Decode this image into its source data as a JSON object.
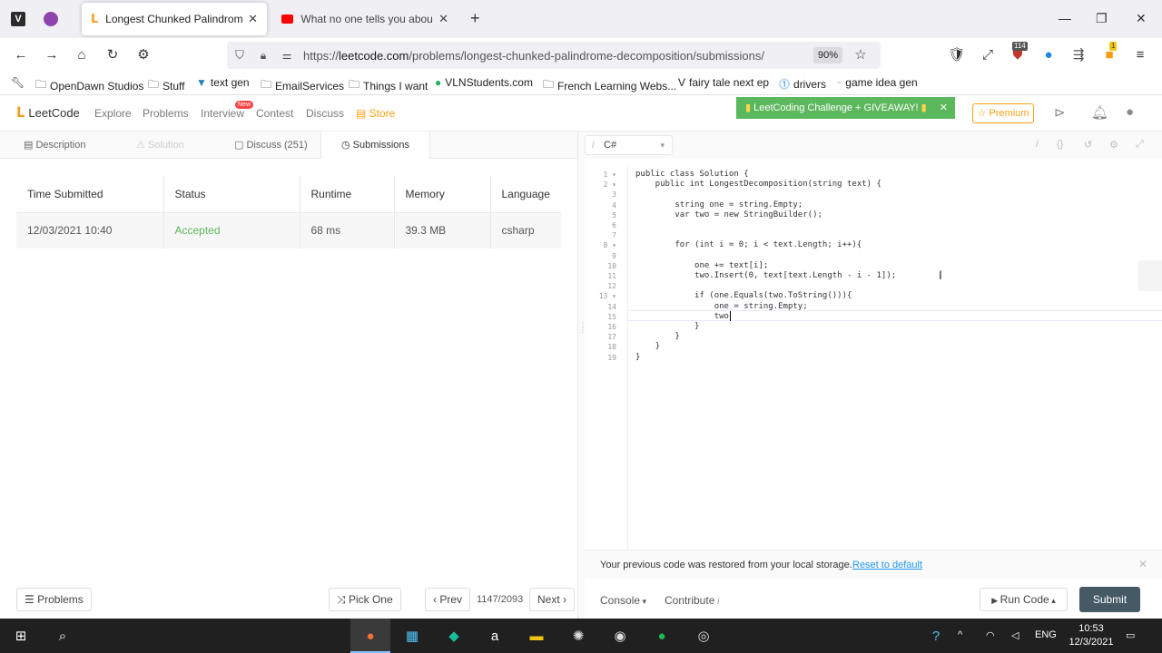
{
  "browser": {
    "tabs": [
      {
        "title": "Longest Chunked Palindrome Decomposition - LeetCode",
        "active": true
      },
      {
        "title": "What no one tells you about coding",
        "active": false
      }
    ],
    "new_tab": "+",
    "controls": {
      "minimize": "—",
      "maximize": "❐",
      "close": "✕"
    },
    "url_prefix": "https://",
    "url_domain": "leetcode.com",
    "url_path": "/problems/longest-chunked-palindrome-decomposition/submissions/",
    "zoom": "90%",
    "ext_badges": {
      "pocket_count": "114",
      "reader_count": "1"
    },
    "bookmarks": [
      "OpenDawn Studios",
      "Stuff",
      "text gen",
      "EmailServices",
      "Things I want",
      "VLNStudents.com",
      "French Learning Webs...",
      "fairy tale next ep",
      "drivers",
      "game idea gen"
    ]
  },
  "leetcode_nav": {
    "logo": "LeetCode",
    "links": [
      "Explore",
      "Problems",
      "Interview",
      "Contest",
      "Discuss",
      "Store"
    ],
    "new_badge": "New",
    "challenge": "LeetCoding Challenge + GIVEAWAY!",
    "premium": "Premium"
  },
  "left_panel": {
    "tabs": [
      "Description",
      "Solution",
      "Discuss (251)",
      "Submissions"
    ],
    "table_headers": [
      "Time Submitted",
      "Status",
      "Runtime",
      "Memory",
      "Language"
    ],
    "rows": [
      [
        "12/03/2021 10:40",
        "Accepted",
        "68 ms",
        "39.3 MB",
        "csharp"
      ]
    ],
    "bottom": {
      "problems": "Problems",
      "pick_one": "Pick One",
      "prev": "Prev",
      "page": "1147/2093",
      "next": "Next"
    }
  },
  "editor": {
    "language": "C#",
    "lines": [
      "public class Solution {",
      "    public int LongestDecomposition(string text) {",
      "",
      "        string one = string.Empty;",
      "        var two = new StringBuilder();",
      "",
      "",
      "        for (int i = 0; i < text.Length; i++){",
      "",
      "            one += text[i];",
      "            two.Insert(0, text[text.Length - i - 1]);",
      "",
      "            if (one.Equals(two.ToString())){",
      "                one = string.Empty;",
      "                two",
      "            }",
      "        }",
      "    }",
      "}"
    ],
    "fold_lines": [
      1,
      2,
      8,
      13
    ],
    "restore_msg": "Your previous code was restored from your local storage.",
    "reset_link": "Reset to default",
    "console": "Console",
    "contribute": "Contribute",
    "run_code": "Run Code",
    "submit": "Submit"
  },
  "taskbar": {
    "lang": "ENG",
    "time": "10:53",
    "date": "12/3/2021"
  },
  "colors": {
    "accepted": "#5cb85c",
    "submit_bg": "#455a64",
    "challenge_bg": "#5cb85c",
    "premium": "#ffa116"
  }
}
